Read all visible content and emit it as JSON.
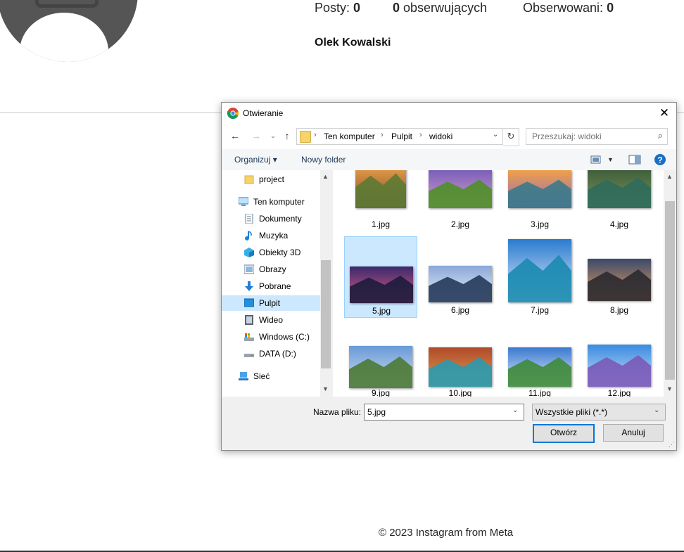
{
  "profile": {
    "stats": [
      {
        "label": "Posty: ",
        "value": "0",
        "value_first": false
      },
      {
        "label": " obserwujących",
        "value": "0",
        "value_first": true
      },
      {
        "label": "Obserwowani: ",
        "value": "0",
        "value_first": false
      }
    ],
    "name": "Olek Kowalski",
    "footer": "© 2023 Instagram from Meta"
  },
  "dialog": {
    "title": "Otwieranie",
    "breadcrumb": [
      "Ten komputer",
      "Pulpit",
      "widoki"
    ],
    "search_placeholder": "Przeszukaj: widoki",
    "toolbar": {
      "organize": "Organizuj ▾",
      "new_folder": "Nowy folder"
    },
    "sidebar": [
      {
        "label": "project",
        "icon": "folder-icon",
        "indent": 1
      },
      {
        "label": "Ten komputer",
        "icon": "computer-icon",
        "indent": 0
      },
      {
        "label": "Dokumenty",
        "icon": "documents-icon",
        "indent": 1
      },
      {
        "label": "Muzyka",
        "icon": "music-icon",
        "indent": 1
      },
      {
        "label": "Obiekty 3D",
        "icon": "objects-3d-icon",
        "indent": 1
      },
      {
        "label": "Obrazy",
        "icon": "pictures-icon",
        "indent": 1
      },
      {
        "label": "Pobrane",
        "icon": "download-icon",
        "indent": 1
      },
      {
        "label": "Pulpit",
        "icon": "desktop-icon",
        "indent": 1,
        "selected": true
      },
      {
        "label": "Wideo",
        "icon": "video-icon",
        "indent": 1
      },
      {
        "label": "Windows (C:)",
        "icon": "drive-c-icon",
        "indent": 1
      },
      {
        "label": "DATA (D:)",
        "icon": "drive-d-icon",
        "indent": 1
      },
      {
        "label": "Sieć",
        "icon": "network-icon",
        "indent": 0
      }
    ],
    "files": [
      {
        "name": "1.jpg",
        "selected": false
      },
      {
        "name": "2.jpg",
        "selected": false
      },
      {
        "name": "3.jpg",
        "selected": false
      },
      {
        "name": "4.jpg",
        "selected": false
      },
      {
        "name": "5.jpg",
        "selected": true
      },
      {
        "name": "6.jpg",
        "selected": false
      },
      {
        "name": "7.jpg",
        "selected": false
      },
      {
        "name": "8.jpg",
        "selected": false
      },
      {
        "name": "9.jpg",
        "selected": false
      },
      {
        "name": "10.jpg",
        "selected": false
      },
      {
        "name": "11.jpg",
        "selected": false
      },
      {
        "name": "12.jpg",
        "selected": false
      }
    ],
    "filename_label": "Nazwa pliku:",
    "filename_value": "5.jpg",
    "filter_value": "Wszystkie pliki (*.*)",
    "open_label": "Otwórz",
    "cancel_label": "Anuluj"
  },
  "colors": {
    "selection": "#cce8ff",
    "accent": "#0078d7",
    "avatar": "#555555"
  }
}
